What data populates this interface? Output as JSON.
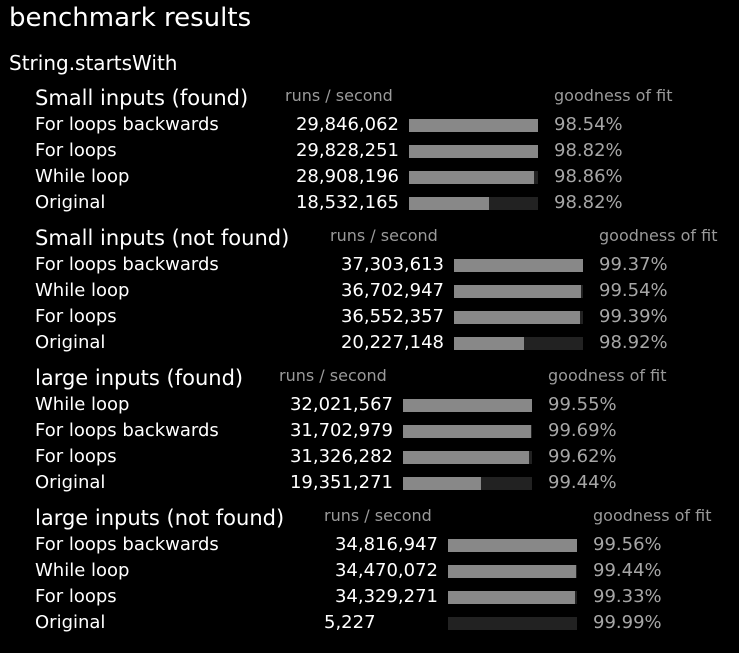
{
  "title": "benchmark results",
  "benchmark": "String.startsWith",
  "groups": [
    {
      "title": "Small inputs (found)",
      "runs_header": "runs / second",
      "fit_header": "goodness of fit",
      "rows": [
        {
          "name": "For loops backwards",
          "runs": "29,846,062",
          "fit": "98.54%",
          "fraction": 1.0
        },
        {
          "name": "For loops",
          "runs": "29,828,251",
          "fit": "98.82%",
          "fraction": 0.9994
        },
        {
          "name": "While loop",
          "runs": "28,908,196",
          "fit": "98.86%",
          "fraction": 0.9686
        },
        {
          "name": "Original",
          "runs": "18,532,165",
          "fit": "98.82%",
          "fraction": 0.6209
        }
      ]
    },
    {
      "title": "Small inputs (not found)",
      "runs_header": "runs / second",
      "fit_header": "goodness of fit",
      "rows": [
        {
          "name": "For loops backwards",
          "runs": "37,303,613",
          "fit": "99.37%",
          "fraction": 1.0
        },
        {
          "name": "While loop",
          "runs": "36,702,947",
          "fit": "99.54%",
          "fraction": 0.9839
        },
        {
          "name": "For loops",
          "runs": "36,552,357",
          "fit": "99.39%",
          "fraction": 0.9799
        },
        {
          "name": "Original",
          "runs": "20,227,148",
          "fit": "98.92%",
          "fraction": 0.5422
        }
      ]
    },
    {
      "title": "large inputs (found)",
      "runs_header": "runs / second",
      "fit_header": "goodness of fit",
      "rows": [
        {
          "name": "While loop",
          "runs": "32,021,567",
          "fit": "99.55%",
          "fraction": 1.0
        },
        {
          "name": "For loops backwards",
          "runs": "31,702,979",
          "fit": "99.69%",
          "fraction": 0.9901
        },
        {
          "name": "For loops",
          "runs": "31,326,282",
          "fit": "99.62%",
          "fraction": 0.9783
        },
        {
          "name": "Original",
          "runs": "19,351,271",
          "fit": "99.44%",
          "fraction": 0.6043
        }
      ]
    },
    {
      "title": "large inputs (not found)",
      "runs_header": "runs / second",
      "fit_header": "goodness of fit",
      "rows": [
        {
          "name": "For loops backwards",
          "runs": "34,816,947",
          "fit": "99.56%",
          "fraction": 1.0
        },
        {
          "name": "While loop",
          "runs": "34,470,072",
          "fit": "99.44%",
          "fraction": 0.99
        },
        {
          "name": "For loops",
          "runs": "34,329,271",
          "fit": "99.33%",
          "fraction": 0.986
        },
        {
          "name": "Original",
          "runs": "5,227",
          "fit": "99.99%",
          "fraction": 0.0002
        }
      ]
    }
  ]
}
